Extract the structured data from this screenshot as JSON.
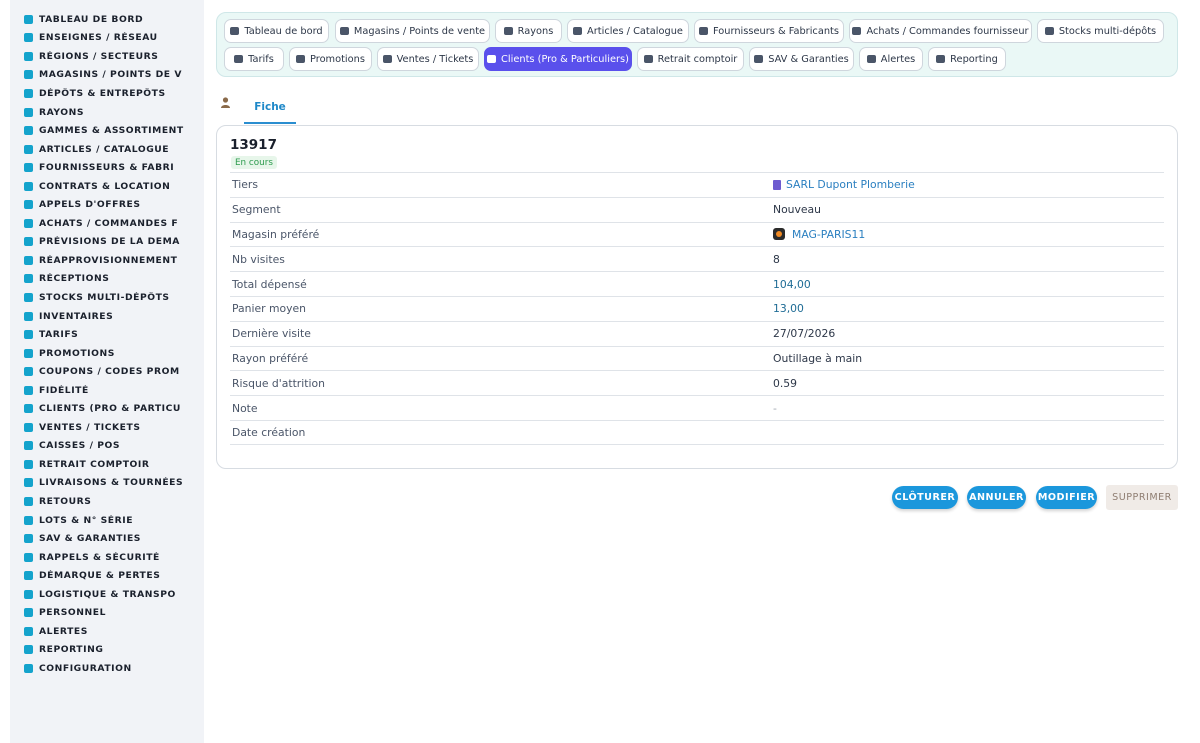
{
  "sidebar": {
    "items": [
      {
        "label": "TABLEAU DE BORD",
        "icon": "dashboard-icon"
      },
      {
        "label": "ENSEIGNES / RÉSEAU",
        "icon": "flag-icon"
      },
      {
        "label": "RÉGIONS / SECTEURS",
        "icon": "map-icon"
      },
      {
        "label": "MAGASINS / POINTS DE V",
        "icon": "store-icon"
      },
      {
        "label": "DÉPÔTS & ENTREPÔTS",
        "icon": "warehouse-icon"
      },
      {
        "label": "RAYONS",
        "icon": "shelf-icon"
      },
      {
        "label": "GAMMES & ASSORTIMENT",
        "icon": "layers-icon"
      },
      {
        "label": "ARTICLES / CATALOGUE",
        "icon": "box-icon"
      },
      {
        "label": "FOURNISSEURS & FABRI",
        "icon": "truck-icon"
      },
      {
        "label": "CONTRATS & LOCATION",
        "icon": "document-icon"
      },
      {
        "label": "APPELS D'OFFRES",
        "icon": "gavel-icon"
      },
      {
        "label": "ACHATS / COMMANDES F",
        "icon": "cart-icon"
      },
      {
        "label": "PRÉVISIONS DE LA DEMA",
        "icon": "chart-icon"
      },
      {
        "label": "RÉAPPROVISIONNEMENT",
        "icon": "refresh-icon"
      },
      {
        "label": "RÉCEPTIONS",
        "icon": "dolly-icon"
      },
      {
        "label": "STOCKS MULTI-DÉPÔTS",
        "icon": "stock-icon"
      },
      {
        "label": "INVENTAIRES",
        "icon": "clipboard-icon"
      },
      {
        "label": "TARIFS",
        "icon": "tag-icon"
      },
      {
        "label": "PROMOTIONS",
        "icon": "percent-icon"
      },
      {
        "label": "COUPONS / CODES PROM",
        "icon": "ticket-icon"
      },
      {
        "label": "FIDÉLITÉ",
        "icon": "card-icon"
      },
      {
        "label": "CLIENTS (PRO & PARTICU",
        "icon": "user-icon"
      },
      {
        "label": "VENTES / TICKETS",
        "icon": "receipt-icon"
      },
      {
        "label": "CAISSES / POS",
        "icon": "cash-register-icon"
      },
      {
        "label": "RETRAIT COMPTOIR",
        "icon": "car-icon"
      },
      {
        "label": "LIVRAISONS & TOURNÉES",
        "icon": "delivery-icon"
      },
      {
        "label": "RETOURS",
        "icon": "undo-icon"
      },
      {
        "label": "LOTS & N° SÉRIE",
        "icon": "barcode-icon"
      },
      {
        "label": "SAV & GARANTIES",
        "icon": "tools-icon"
      },
      {
        "label": "RAPPELS & SÉCURITÉ",
        "icon": "warning-icon"
      },
      {
        "label": "DÉMARQUE & PERTES",
        "icon": "trash-icon"
      },
      {
        "label": "LOGISTIQUE & TRANSPO",
        "icon": "route-icon"
      },
      {
        "label": "PERSONNEL",
        "icon": "users-icon"
      },
      {
        "label": "ALERTES",
        "icon": "bell-icon"
      },
      {
        "label": "REPORTING",
        "icon": "pie-chart-icon"
      },
      {
        "label": "CONFIGURATION",
        "icon": "gear-icon"
      }
    ]
  },
  "topnav": {
    "tabs": [
      {
        "label": "Tableau de bord",
        "icon": "dashboard-icon",
        "active": false
      },
      {
        "label": "Magasins / Points de vente",
        "icon": "store-icon",
        "active": false
      },
      {
        "label": "Rayons",
        "icon": "shelf-icon",
        "active": false
      },
      {
        "label": "Articles / Catalogue",
        "icon": "box-icon",
        "active": false
      },
      {
        "label": "Fournisseurs & Fabricants",
        "icon": "truck-icon",
        "active": false
      },
      {
        "label": "Achats / Commandes fournisseur",
        "icon": "cart-icon",
        "active": false
      },
      {
        "label": "Stocks multi-dépôts",
        "icon": "stock-icon",
        "active": false
      },
      {
        "label": "Tarifs",
        "icon": "tag-icon",
        "active": false
      },
      {
        "label": "Promotions",
        "icon": "percent-icon",
        "active": false
      },
      {
        "label": "Ventes / Tickets",
        "icon": "receipt-icon",
        "active": false
      },
      {
        "label": "Clients (Pro & Particuliers)",
        "icon": "user-icon",
        "active": true
      },
      {
        "label": "Retrait comptoir",
        "icon": "car-icon",
        "active": false
      },
      {
        "label": "SAV & Garanties",
        "icon": "tools-icon",
        "active": false
      },
      {
        "label": "Alertes",
        "icon": "bell-icon",
        "active": false
      },
      {
        "label": "Reporting",
        "icon": "pie-chart-icon",
        "active": false
      }
    ]
  },
  "subtabs": {
    "fiche_label": "Fiche"
  },
  "record": {
    "id": "13917",
    "status": "En cours",
    "fields": [
      {
        "label": "Tiers",
        "value": "SARL Dupont Plomberie",
        "style": "link",
        "icon": "building-icon"
      },
      {
        "label": "Segment",
        "value": "Nouveau",
        "style": "plain"
      },
      {
        "label": "Magasin préféré",
        "value": "MAG-PARIS11",
        "style": "link",
        "icon": "store-logo-icon"
      },
      {
        "label": "Nb visites",
        "value": "8",
        "style": "plain"
      },
      {
        "label": "Total dépensé",
        "value": "104,00",
        "style": "money"
      },
      {
        "label": "Panier moyen",
        "value": "13,00",
        "style": "money"
      },
      {
        "label": "Dernière visite",
        "value": "27/07/2026",
        "style": "plain"
      },
      {
        "label": "Rayon préféré",
        "value": "Outillage à main",
        "style": "plain"
      },
      {
        "label": "Risque d'attrition",
        "value": "0.59",
        "style": "plain"
      },
      {
        "label": "Note",
        "value": "-",
        "style": "dash"
      },
      {
        "label": "Date création",
        "value": "",
        "style": "plain"
      }
    ]
  },
  "actions": {
    "close": "CLÔTURER",
    "cancel": "ANNULER",
    "edit": "MODIFIER",
    "delete": "SUPPRIMER"
  },
  "colors": {
    "accent": "#1b97dc",
    "active_tab": "#5a50ec",
    "sidebar_icon": "#14a3cc",
    "status_green": "#2c9b4d"
  }
}
